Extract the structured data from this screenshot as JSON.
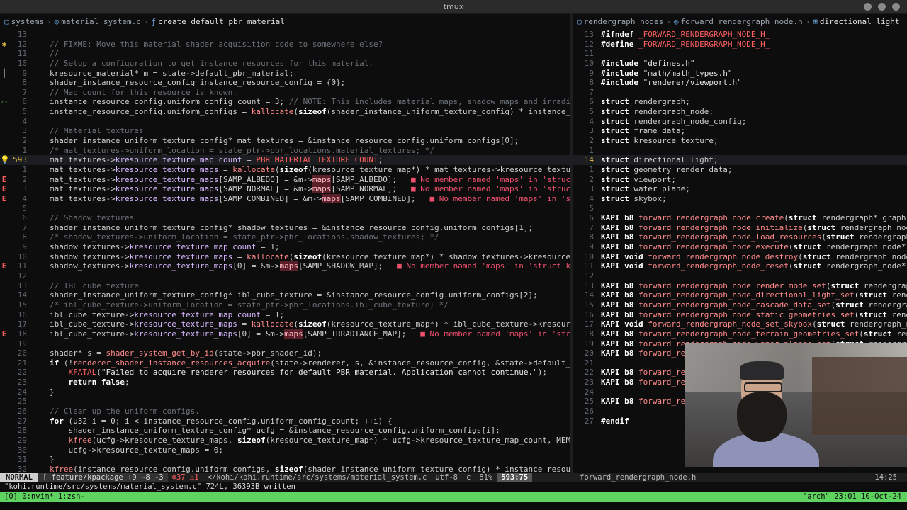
{
  "window_title": "tmux",
  "left": {
    "breadcrumb": [
      "systems",
      "material_system.c",
      "create_default_pbr_material"
    ],
    "lines": [
      {
        "n": "13",
        "sign": "",
        "html": ""
      },
      {
        "n": "12",
        "sign": "w",
        "html": "<span class=\"cm\">// FIXME: Move this material shader acquisition code to somewhere else?</span>"
      },
      {
        "n": "11",
        "sign": "",
        "html": "<span class=\"cm\">//</span>"
      },
      {
        "n": "10",
        "sign": "",
        "html": "<span class=\"cm\">// Setup a configuration to get instance resources for this material.</span>"
      },
      {
        "n": "9",
        "sign": "bar",
        "html": "kresource_material* m = state-&gt;default_pbr_material;"
      },
      {
        "n": "8",
        "sign": "",
        "html": "shader_instance_resource_config instance_resource_config = {0};"
      },
      {
        "n": "7",
        "sign": "",
        "html": "<span class=\"cm\">// Map count for this resource is known.</span>"
      },
      {
        "n": "6",
        "sign": "g",
        "html": "instance_resource_config.uniform_config_count = 3; <span class=\"cm\">// NOTE: This includes material maps, shadow maps and irradiance</span>"
      },
      {
        "n": "5",
        "sign": "",
        "html": "instance_resource_config.uniform_configs = <span class=\"fx\">kallocate</span>(<span class=\"kw\">sizeof</span>(shader_instance_uniform_texture_config) * instance_resou"
      },
      {
        "n": "4",
        "sign": "",
        "html": ""
      },
      {
        "n": "3",
        "sign": "",
        "html": "<span class=\"cm\">// Material textures</span>"
      },
      {
        "n": "2",
        "sign": "",
        "html": "shader_instance_uniform_texture_config* mat_textures = &amp;instance_resource_config.uniform_configs[0];"
      },
      {
        "n": "1",
        "sign": "",
        "html": "<span class=\"cm\">/* mat_textures-&gt;uniform_location = state_ptr-&gt;pbr_locations.material_textures; */</span>"
      },
      {
        "n": "593",
        "sign": "w",
        "cur": true,
        "html": "mat_textures-&gt;<span class=\"fld\">kresource_texture_map_count</span> = <span class=\"mac\">PBR_MATERIAL_TEXTURE_COUNT</span>;"
      },
      {
        "n": "1",
        "sign": "",
        "html": "mat_textures-&gt;<span class=\"fld\">kresource_texture_maps</span> = <span class=\"fx\">kallocate</span>(<span class=\"kw\">sizeof</span>(kresource_texture_map*) * mat_textures-&gt;kresource_texture_ma"
      },
      {
        "n": "2",
        "sign": "e",
        "html": "mat_textures-&gt;<span class=\"fld\">kresource_texture_maps</span>[SAMP_ALBEDO] = &amp;m-&gt;<span class=\"hl\">maps</span>[SAMP_ALBEDO];   <span class=\"err\">■ No member named 'maps' in 'struct k</span>"
      },
      {
        "n": "3",
        "sign": "e",
        "html": "mat_textures-&gt;<span class=\"fld\">kresource_texture_maps</span>[SAMP_NORMAL] = &amp;m-&gt;<span class=\"hl\">maps</span>[SAMP_NORMAL];   <span class=\"err\">■ No member named 'maps' in 'struct k</span>"
      },
      {
        "n": "4",
        "sign": "e",
        "html": "mat_textures-&gt;<span class=\"fld\">kresource_texture_maps</span>[SAMP_COMBINED] = &amp;m-&gt;<span class=\"hl\">maps</span>[SAMP_COMBINED];   <span class=\"err\">■ No member named 'maps' in 'struc</span>"
      },
      {
        "n": "5",
        "sign": "",
        "html": ""
      },
      {
        "n": "6",
        "sign": "",
        "html": "<span class=\"cm\">// Shadow textures</span>"
      },
      {
        "n": "7",
        "sign": "",
        "html": "shader_instance_uniform_texture_config* shadow_textures = &amp;instance_resource_config.uniform_configs[1];"
      },
      {
        "n": "8",
        "sign": "",
        "html": "<span class=\"cm\">/* shadow_textures-&gt;uniform_location = state_ptr-&gt;pbr_locations.shadow_textures; */</span>"
      },
      {
        "n": "9",
        "sign": "",
        "html": "shadow_textures-&gt;<span class=\"fld\">kresource_texture_map_count</span> = 1;"
      },
      {
        "n": "10",
        "sign": "",
        "html": "shadow_textures-&gt;<span class=\"fld\">kresource_texture_maps</span> = <span class=\"fx\">kallocate</span>(<span class=\"kw\">sizeof</span>(kresource_texture_map*) * shadow_textures-&gt;kresource_text"
      },
      {
        "n": "11",
        "sign": "e",
        "html": "shadow_textures-&gt;<span class=\"fld\">kresource_texture_maps</span>[0] = &amp;m-&gt;<span class=\"hl\">maps</span>[SAMP_SHADOW_MAP];   <span class=\"err\">■ No member named 'maps' in 'struct kres</span>"
      },
      {
        "n": "12",
        "sign": "",
        "html": ""
      },
      {
        "n": "13",
        "sign": "",
        "html": "<span class=\"cm\">// IBL cube texture</span>"
      },
      {
        "n": "14",
        "sign": "",
        "html": "shader_instance_uniform_texture_config* ibl_cube_texture = &amp;instance_resource_config.uniform_configs[2];"
      },
      {
        "n": "15",
        "sign": "",
        "html": "<span class=\"cm\">/* ibl_cube_texture-&gt;uniform_location = state_ptr-&gt;pbr_locations.ibl_cube_texture; */</span>"
      },
      {
        "n": "16",
        "sign": "",
        "html": "ibl_cube_texture-&gt;<span class=\"fld\">kresource_texture_map_count</span> = 1;"
      },
      {
        "n": "17",
        "sign": "",
        "html": "ibl_cube_texture-&gt;<span class=\"fld\">kresource_texture_maps</span> = <span class=\"fx\">kallocate</span>(<span class=\"kw\">sizeof</span>(kresource_texture_map*) * ibl_cube_texture-&gt;kresource_te"
      },
      {
        "n": "18",
        "sign": "e",
        "html": "ibl_cube_texture-&gt;<span class=\"fld\">kresource_texture_maps</span>[0] = &amp;m-&gt;<span class=\"hl\">maps</span>[SAMP_IRRADIANCE_MAP];   <span class=\"err\">■ No member named 'maps' in 'struct</span>"
      },
      {
        "n": "19",
        "sign": "",
        "html": ""
      },
      {
        "n": "20",
        "sign": "",
        "html": "shader* s = <span class=\"fx\">shader_system_get_by_id</span>(state-&gt;pbr_shader_id);"
      },
      {
        "n": "21",
        "sign": "",
        "html": "<span class=\"kw\">if</span> (!<span class=\"fx\">renderer_shader_instance_resources_acquire</span>(state-&gt;renderer, s, &amp;instance_resource_config, &amp;state-&gt;default_pbr_m"
      },
      {
        "n": "22",
        "sign": "",
        "html": "    <span class=\"mac\">KFATAL</span>(<span class=\"str\">\"Failed to acquire renderer resources for default PBR material. Application cannot continue.\"</span>);"
      },
      {
        "n": "23",
        "sign": "",
        "html": "    <span class=\"kw\">return false</span>;"
      },
      {
        "n": "24",
        "sign": "",
        "html": "}"
      },
      {
        "n": "25",
        "sign": "",
        "html": ""
      },
      {
        "n": "26",
        "sign": "",
        "html": "<span class=\"cm\">// Clean up the uniform configs.</span>"
      },
      {
        "n": "27",
        "sign": "",
        "html": "<span class=\"kw\">for</span> (u32 i = 0; i &lt; instance_resource_config.uniform_config_count; ++i) {"
      },
      {
        "n": "28",
        "sign": "",
        "html": "    shader_instance_uniform_texture_config* ucfg = &amp;instance_resource_config.uniform_configs[i];"
      },
      {
        "n": "29",
        "sign": "",
        "html": "    <span class=\"fx\">kfree</span>(ucfg-&gt;kresource_texture_maps, <span class=\"kw\">sizeof</span>(kresource_texture_map*) * ucfg-&gt;kresource_texture_map_count, MEMORY_T"
      },
      {
        "n": "30",
        "sign": "",
        "html": "    ucfg-&gt;kresource_texture_maps = 0;"
      },
      {
        "n": "31",
        "sign": "",
        "html": "}"
      },
      {
        "n": "32",
        "sign": "",
        "html": "<span class=\"fx\">kfree</span>(instance_resource_config.uniform_configs, <span class=\"kw\">sizeof</span>(shader_instance_uniform_texture_config) * instance_resource_c"
      }
    ]
  },
  "right": {
    "breadcrumb": [
      "rendergraph_nodes",
      "forward_rendergraph_node.h",
      "directional_light"
    ],
    "lines": [
      {
        "n": "13",
        "html": "<span class=\"pp\">#ifndef</span> <span class=\"mac\">_FORWARD_RENDERGRAPH_NODE_H_</span>"
      },
      {
        "n": "12",
        "html": "<span class=\"pp\">#define</span> <span class=\"mac\">_FORWARD_RENDERGRAPH_NODE_H_</span>"
      },
      {
        "n": "11",
        "html": ""
      },
      {
        "n": "10",
        "html": "<span class=\"pp\">#include</span> <span class=\"str\">\"defines.h\"</span>"
      },
      {
        "n": "9",
        "html": "<span class=\"pp\">#include</span> <span class=\"str\">\"math/math_types.h\"</span>"
      },
      {
        "n": "8",
        "html": "<span class=\"pp\">#include</span> <span class=\"str\">\"renderer/viewport.h\"</span>"
      },
      {
        "n": "7",
        "html": ""
      },
      {
        "n": "6",
        "html": "<span class=\"kw\">struct</span> rendergraph;"
      },
      {
        "n": "5",
        "html": "<span class=\"kw\">struct</span> rendergraph_node;"
      },
      {
        "n": "4",
        "html": "<span class=\"kw\">struct</span> rendergraph_node_config;"
      },
      {
        "n": "3",
        "html": "<span class=\"kw\">struct</span> frame_data;"
      },
      {
        "n": "2",
        "html": "<span class=\"kw\">struct</span> kresource_texture;"
      },
      {
        "n": "1",
        "html": ""
      },
      {
        "n": "14",
        "cur": true,
        "html": "<span class=\"kw\">struct</span> directional_light;"
      },
      {
        "n": "1",
        "html": "<span class=\"kw\">struct</span> geometry_render_data;"
      },
      {
        "n": "2",
        "html": "<span class=\"kw\">struct</span> viewport;"
      },
      {
        "n": "3",
        "html": "<span class=\"kw\">struct</span> water_plane;"
      },
      {
        "n": "4",
        "html": "<span class=\"kw\">struct</span> skybox;"
      },
      {
        "n": "5",
        "html": ""
      },
      {
        "n": "6",
        "html": "<span class=\"kw\">KAPI b8</span> <span class=\"fx\">forward_rendergraph_node_create</span>(<span class=\"kw\">struct</span> rendergraph* graph,"
      },
      {
        "n": "7",
        "html": "<span class=\"kw\">KAPI b8</span> <span class=\"fx\">forward_rendergraph_node_initialize</span>(<span class=\"kw\">struct</span> rendergraph_node"
      },
      {
        "n": "8",
        "html": "<span class=\"kw\">KAPI b8</span> <span class=\"fx\">forward_rendergraph_node_load_resources</span>(<span class=\"kw\">struct</span> rendergraph_"
      },
      {
        "n": "9",
        "html": "<span class=\"kw\">KAPI b8</span> <span class=\"fx\">forward_rendergraph_node_execute</span>(<span class=\"kw\">struct</span> rendergraph_node* s"
      },
      {
        "n": "10",
        "html": "<span class=\"kw\">KAPI void</span> <span class=\"fx\">forward_rendergraph_node_destroy</span>(<span class=\"kw\">struct</span> rendergraph_node*"
      },
      {
        "n": "11",
        "html": "<span class=\"kw\">KAPI void</span> <span class=\"fx\">forward_rendergraph_node_reset</span>(<span class=\"kw\">struct</span> rendergraph_node* s"
      },
      {
        "n": "12",
        "html": ""
      },
      {
        "n": "13",
        "html": "<span class=\"kw\">KAPI b8</span> <span class=\"fx\">forward_rendergraph_node_render_mode_set</span>(<span class=\"kw\">struct</span> rendergraph"
      },
      {
        "n": "14",
        "html": "<span class=\"kw\">KAPI b8</span> <span class=\"fx\">forward_rendergraph_node_directional_light_set</span>(<span class=\"kw\">struct</span> rende"
      },
      {
        "n": "15",
        "html": "<span class=\"kw\">KAPI b8</span> <span class=\"fx\">forward_rendergraph_node_cascade_data_set</span>(<span class=\"kw\">struct</span> rendergrap"
      },
      {
        "n": "16",
        "html": "<span class=\"kw\">KAPI b8</span> <span class=\"fx\">forward_rendergraph_node_static_geometries_set</span>(<span class=\"kw\">struct</span> rende"
      },
      {
        "n": "17",
        "html": "<span class=\"kw\">KAPI void</span> <span class=\"fx\">forward_rendergraph_node_set_skybox</span>(<span class=\"kw\">struct</span> rendergraph_no"
      },
      {
        "n": "18",
        "html": "<span class=\"kw\">KAPI b8</span> <span class=\"fx\">forward_rendergraph_node_terrain_geometries_set</span>(<span class=\"kw\">struct</span> rend"
      },
      {
        "n": "19",
        "html": "<span class=\"kw\">KAPI b8</span> <span class=\"fx\">forward_rendergraph_node_water_planes_set</span>(<span class=\"kw\">struct</span> rendergrap"
      },
      {
        "n": "20",
        "html": "<span class=\"kw\">KAPI b8</span> <span class=\"fx\">forward_re</span>"
      },
      {
        "n": "21",
        "html": ""
      },
      {
        "n": "22",
        "html": "<span class=\"kw\">KAPI b8</span> <span class=\"fx\">forward_re</span>"
      },
      {
        "n": "23",
        "html": "<span class=\"kw\">KAPI b8</span> <span class=\"fx\">forward_re</span>"
      },
      {
        "n": "24",
        "html": ""
      },
      {
        "n": "25",
        "html": "<span class=\"kw\">KAPI b8</span> <span class=\"fx\">forward_re</span>"
      },
      {
        "n": "26",
        "html": ""
      },
      {
        "n": "27",
        "html": "<span class=\"pp\">#endif</span>"
      }
    ]
  },
  "status": {
    "mode": "NORMAL",
    "branch": "feature/kpackage",
    "diff": "+9 ~8 -3",
    "errors": "37",
    "warnings": "1",
    "path": "</kohi/kohi.runtime/src/systems/material_system.c",
    "encoding": "utf-8",
    "ft": "c",
    "percent": "81%",
    "position": "593:75",
    "right_file": "forward_rendergraph_node.h",
    "right_pos": "14:25"
  },
  "message": "\"kohi.runtime/src/systems/material_system.c\" 724L, 36393B written",
  "tmux": {
    "left": "[0] 0:nvim* 1:zsh-",
    "right": "\"arch\" 23:01 10-Oct-24"
  }
}
